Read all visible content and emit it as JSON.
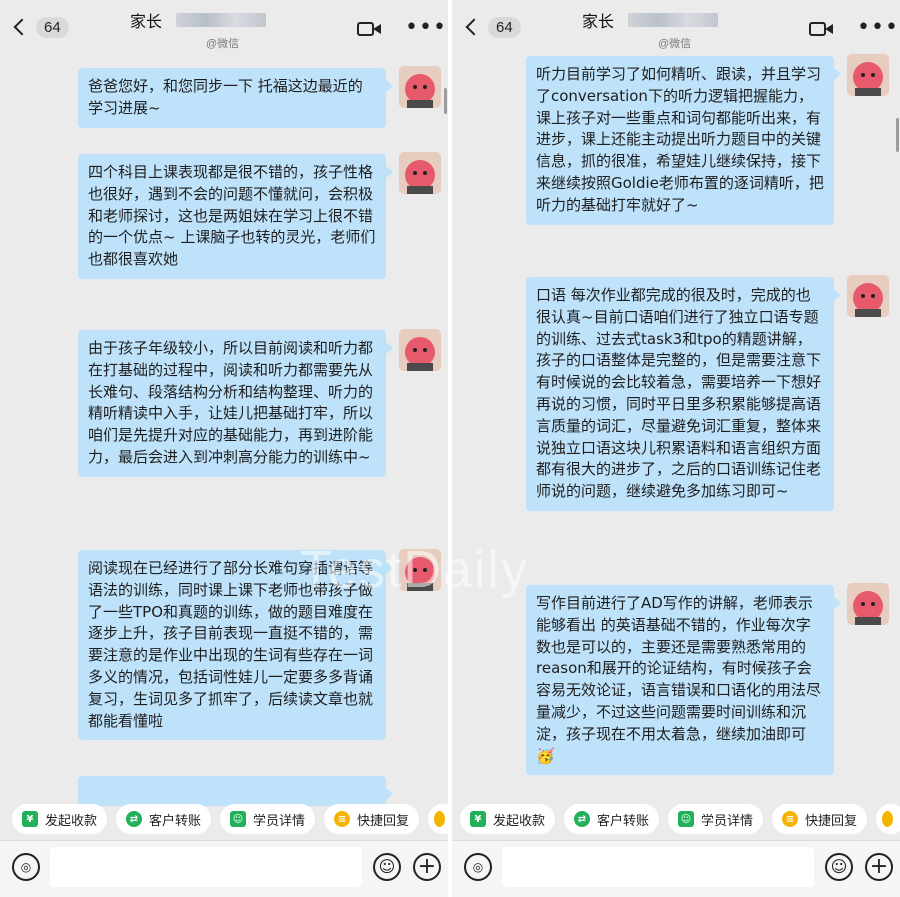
{
  "header": {
    "back_count": "64",
    "title": "家长",
    "subtitle": "@微信"
  },
  "left_messages": [
    {
      "text": "爸爸您好，和您同步一下 托福这边最近的学习进展~"
    },
    {
      "text": "四个科目上课表现都是很不错的，孩子性格也很好，遇到不会的问题不懂就问，会积极和老师探讨，这也是两姐妹在学习上很不错的一个优点~ 上课脑子也转的灵光，老师们也都很喜欢她"
    },
    {
      "text": "由于孩子年级较小，所以目前阅读和听力都在打基础的过程中，阅读和听力都需要先从长难句、段落结构分析和结构整理、听力的精听精读中入手，让娃儿把基础打牢，所以咱们是先提升对应的基础能力，再到进阶能力，最后会进入到冲刺高分能力的训练中~"
    },
    {
      "text": "阅读现在已经进行了部分长难句穿插谓语等语法的训练，同时课上课下老师也带孩子做了一些TPO和真题的训练，做的题目难度在逐步上升，孩子目前表现一直挺不错的，需要注意的是作业中出现的生词有些存在一词多义的情况，包括词性娃儿一定要多多背诵复习，生词见多了抓牢了，后续读文章也就都能看懂啦"
    }
  ],
  "right_messages": [
    {
      "text": "听力目前学习了如何精听、跟读，并且学习了conversation下的听力逻辑把握能力，课上孩子对一些重点和词句都能听出来，有进步，课上还能主动提出听力题目中的关键信息，抓的很准，希望娃儿继续保持，接下来继续按照Goldie老师布置的逐词精听，把听力的基础打牢就好了~"
    },
    {
      "text": "口语 每次作业都完成的很及时，完成的也很认真~目前口语咱们进行了独立口语专题的训练、过去式task3和tpo的精题讲解，孩子的口语整体是完整的，但是需要注意下有时候说的会比较着急，需要培养一下想好再说的习惯，同时平日里多积累能够提高语言质量的词汇，尽量避免词汇重复，整体来说独立口语这块儿积累语料和语言组织方面都有很大的进步了，之后的口语训练记住老师说的问题，继续避免多加练习即可~"
    },
    {
      "text": "写作目前进行了AD写作的讲解，老师表示能够看出 的英语基础不错的，作业每次字数也是可以的，主要还是需要熟悉常用的reason和展开的论证结构，有时候孩子会容易无效论证，语言错误和口语化的用法尽量减少，不过这些问题需要时间训练和沉淀，孩子现在不用太着急，继续加油即可🥳"
    }
  ],
  "quick_actions": [
    {
      "label": "发起收款",
      "icon": "payment-icon",
      "color": "#21b05c"
    },
    {
      "label": "客户转账",
      "icon": "transfer-icon",
      "color": "#21b05c"
    },
    {
      "label": "学员详情",
      "icon": "student-icon",
      "color": "#21b05c"
    },
    {
      "label": "快捷回复",
      "icon": "quick-reply-icon",
      "color": "#f4b400"
    }
  ],
  "watermark": "TestDaily"
}
